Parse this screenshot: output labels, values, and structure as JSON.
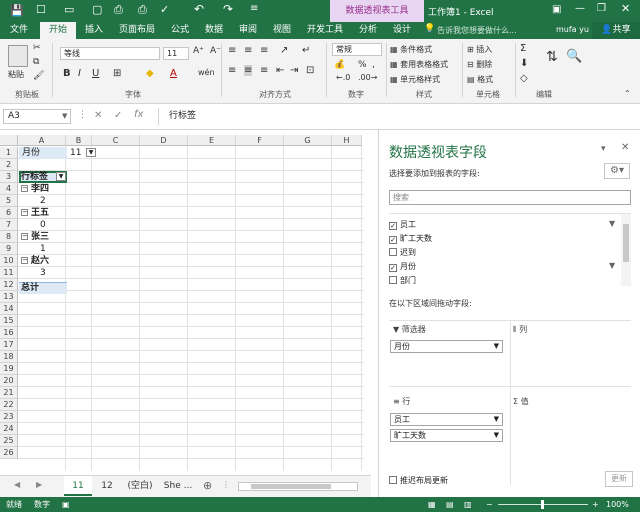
{
  "window": {
    "title": "工作簿1 - Excel",
    "context_tab": "数据透视表工具",
    "user": "mufa yu",
    "share": "共享",
    "tell_me": "告诉我您想要做什么..."
  },
  "tabs": [
    "文件",
    "开始",
    "插入",
    "页面布局",
    "公式",
    "数据",
    "审阅",
    "视图",
    "开发工具",
    "分析",
    "设计"
  ],
  "ribbon": {
    "paste": "粘贴",
    "font_name": "等线",
    "font_size": "11",
    "number_format": "常规",
    "cond_format": "条件格式",
    "table_format": "套用表格格式",
    "cell_style": "单元格样式",
    "insert": "插入",
    "delete": "删除",
    "format": "格式",
    "groups": [
      "剪贴板",
      "字体",
      "对齐方式",
      "数字",
      "样式",
      "单元格",
      "编辑"
    ]
  },
  "formula_bar": {
    "name_box": "A3",
    "content": "行标签"
  },
  "columns": [
    "A",
    "B",
    "C",
    "D",
    "E",
    "F",
    "G",
    "H"
  ],
  "rows": [
    "1",
    "2",
    "3",
    "4",
    "5",
    "6",
    "7",
    "8",
    "9",
    "10",
    "11",
    "12",
    "13",
    "14",
    "15",
    "16",
    "17",
    "18",
    "19",
    "20",
    "21",
    "22",
    "23",
    "24",
    "25",
    "26"
  ],
  "cells": {
    "filter_label": "月份",
    "filter_value": "11",
    "row_label_header": "行标签",
    "items": [
      {
        "name": "李四",
        "value": "2"
      },
      {
        "name": "王五",
        "value": "0"
      },
      {
        "name": "张三",
        "value": "1"
      },
      {
        "name": "赵六",
        "value": "3"
      }
    ],
    "total": "总计"
  },
  "sheet_tabs": [
    "11",
    "12",
    "(空白)",
    "She ..."
  ],
  "status": {
    "left1": "就绪",
    "left2": "数字",
    "zoom": "100%"
  },
  "pivot_pane": {
    "title": "数据透视表字段",
    "subtitle": "选择要添加到报表的字段:",
    "search_placeholder": "搜索",
    "fields": [
      {
        "name": "员工",
        "checked": true,
        "filter": true
      },
      {
        "name": "旷工天数",
        "checked": true,
        "filter": false
      },
      {
        "name": "迟到",
        "checked": false,
        "filter": false
      },
      {
        "name": "月份",
        "checked": true,
        "filter": true
      },
      {
        "name": "部门",
        "checked": false,
        "filter": false
      }
    ],
    "drag_hint": "在以下区域间拖动字段:",
    "filters_label": "筛选器",
    "columns_label": "列",
    "rows_label": "行",
    "values_label": "值",
    "filter_item": "月份",
    "row_items": [
      "员工",
      "旷工天数"
    ],
    "defer": "推迟布局更新",
    "update": "更新"
  },
  "colors": {
    "excel_green": "#217346",
    "header_fill": "#dde9f5"
  }
}
